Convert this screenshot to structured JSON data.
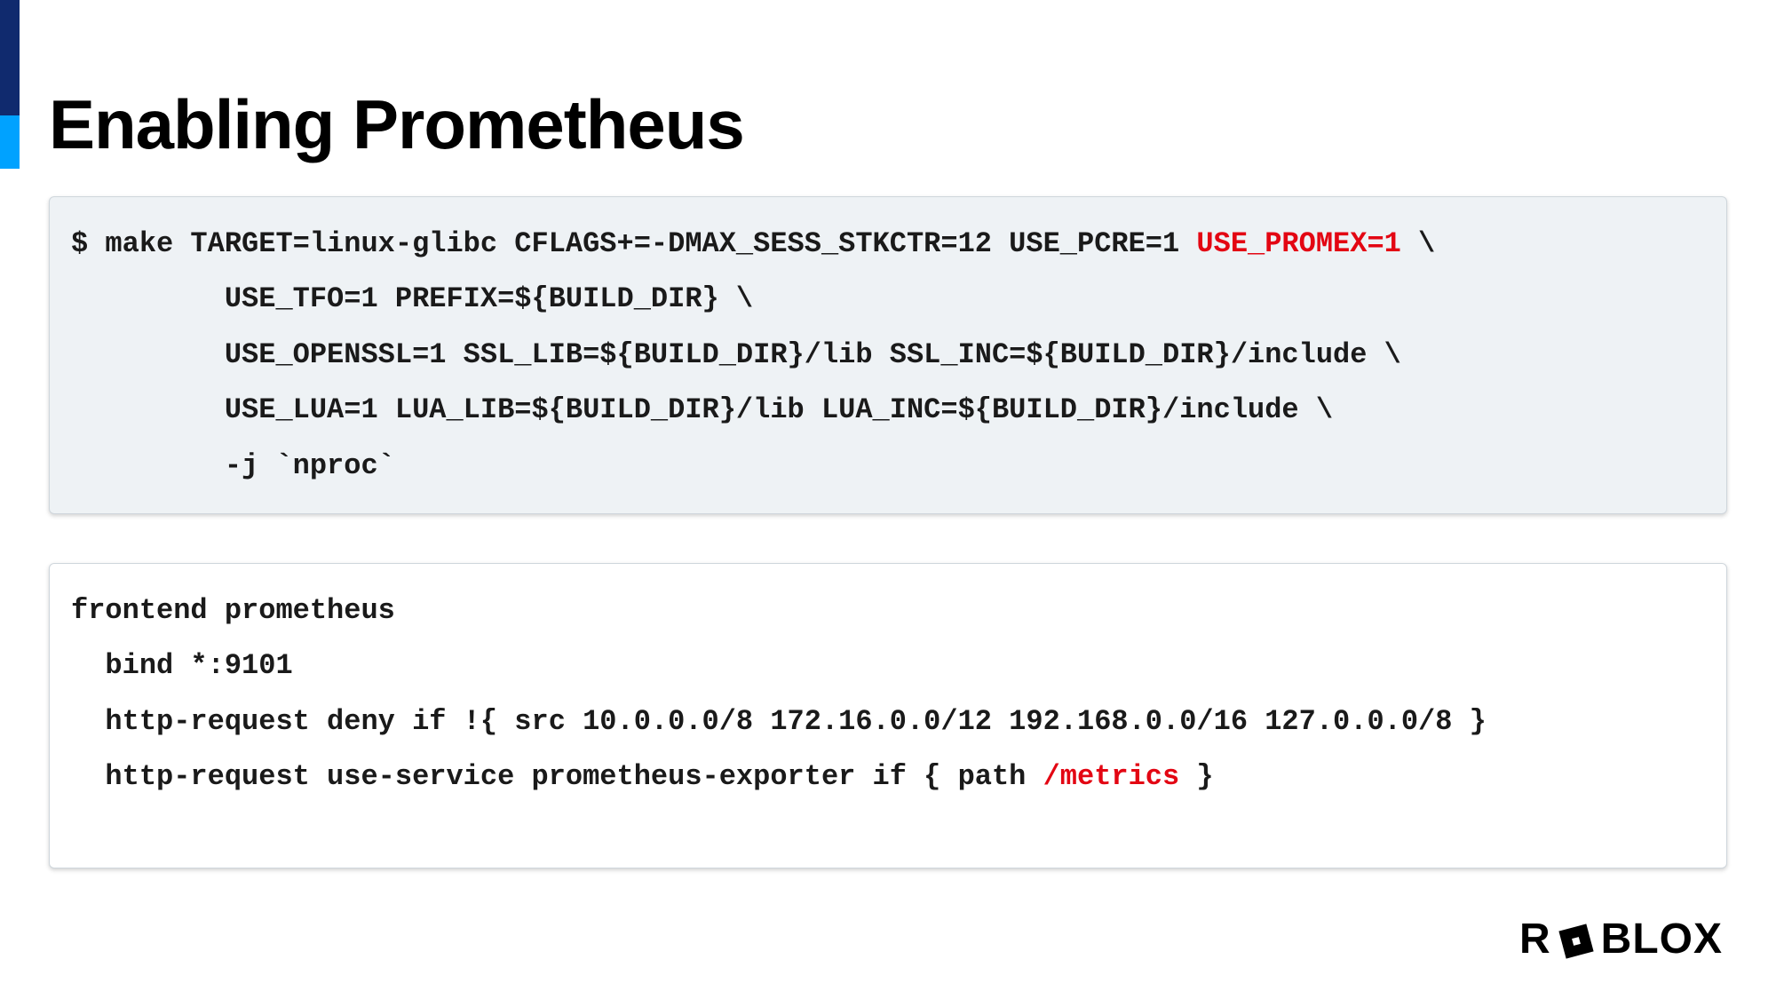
{
  "title": "Enabling Prometheus",
  "block1": {
    "l1a": "$ make TARGET=linux-glibc CFLAGS+=-DMAX_SESS_STKCTR=12 USE_PCRE=1 ",
    "l1hl": "USE_PROMEX=1",
    "l1b": " \\",
    "l2": "         USE_TFO=1 PREFIX=${BUILD_DIR} \\",
    "l3": "         USE_OPENSSL=1 SSL_LIB=${BUILD_DIR}/lib SSL_INC=${BUILD_DIR}/include \\",
    "l4": "         USE_LUA=1 LUA_LIB=${BUILD_DIR}/lib LUA_INC=${BUILD_DIR}/include \\",
    "l5": "         -j `nproc`"
  },
  "block2": {
    "l1": "frontend prometheus",
    "l2": "  bind *:9101",
    "l3": "  http-request deny if !{ src 10.0.0.0/8 172.16.0.0/12 192.168.0.0/16 127.0.0.0/8 }",
    "l4a": "  http-request use-service prometheus-exporter if { path ",
    "l4hl": "/metrics",
    "l4b": " }"
  },
  "logo": {
    "left": "R",
    "right": "BLOX"
  }
}
